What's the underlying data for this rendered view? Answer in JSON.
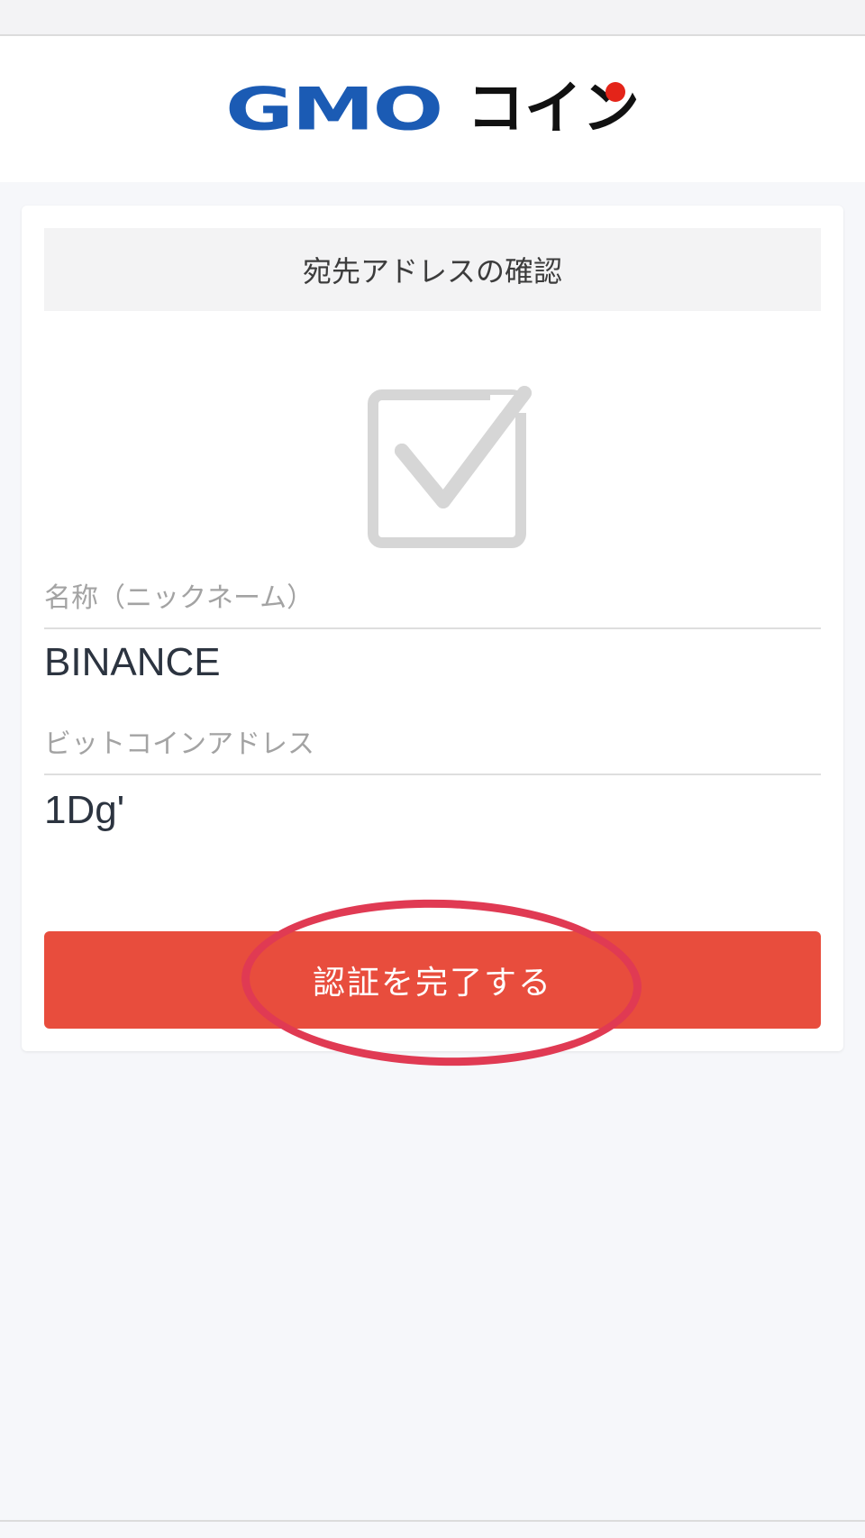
{
  "colors": {
    "gmo_blue": "#1b5bb4",
    "coin_black": "#111111",
    "logo_dot_red": "#e42419",
    "button_red": "#e84d3d",
    "highlight_circle": "#e03a53"
  },
  "logo": {
    "gmo": "GMO",
    "coin": "コイン"
  },
  "card": {
    "title": "宛先アドレスの確認",
    "icon": "checkbox-checked-icon",
    "nickname_label": "名称（ニックネーム）",
    "nickname_value": "BINANCE",
    "address_label": "ビットコインアドレス",
    "address_value": "1Dg'"
  },
  "actions": {
    "submit_label": "認証を完了する"
  }
}
